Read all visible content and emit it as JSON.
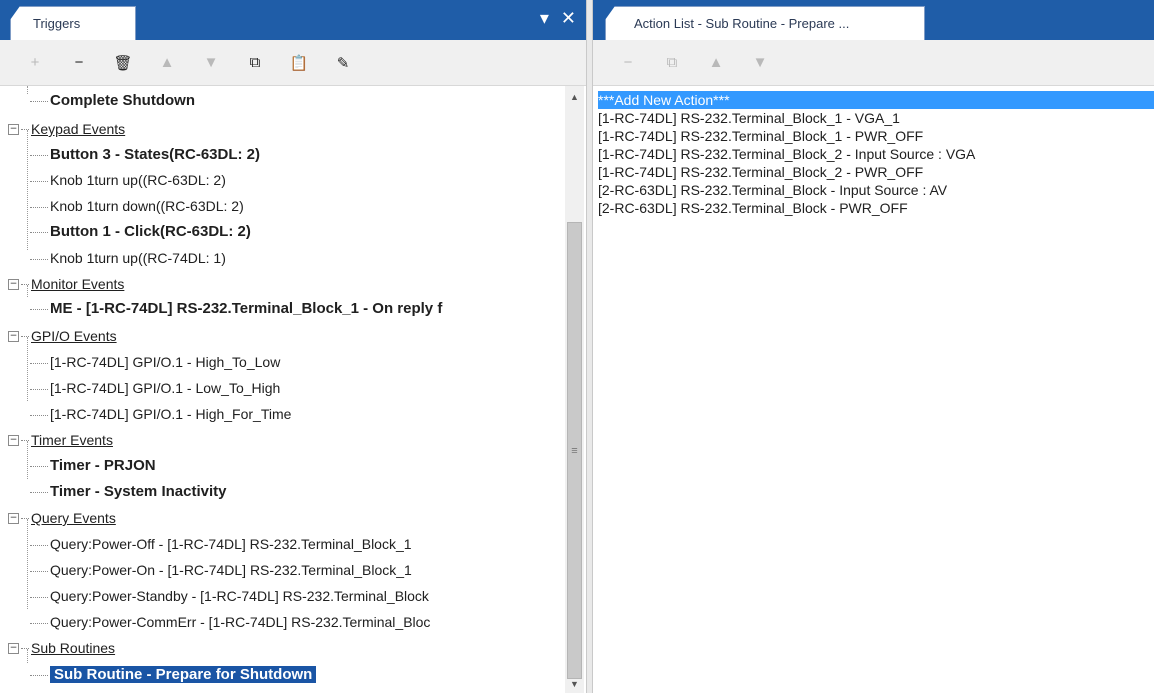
{
  "left": {
    "tab_title": "Triggers",
    "ctrl_dropdown": "▾",
    "ctrl_close": "✕",
    "toolbar": [
      {
        "name": "add-button",
        "glyph": "+",
        "enabled": false
      },
      {
        "name": "remove-button",
        "glyph": "−",
        "enabled": true
      },
      {
        "name": "delete-button",
        "glyph": "🗑",
        "enabled": true
      },
      {
        "name": "move-up-button",
        "glyph": "▲",
        "enabled": false
      },
      {
        "name": "move-down-button",
        "glyph": "▼",
        "enabled": false
      },
      {
        "name": "copy-button",
        "glyph": "⧉",
        "enabled": true
      },
      {
        "name": "paste-button",
        "glyph": "📋",
        "enabled": false
      },
      {
        "name": "edit-button",
        "glyph": "✎",
        "enabled": true
      }
    ],
    "tree": {
      "r0": "Complete Shutdown",
      "cat_keypad": "Keypad Events",
      "k1": "Button 3 - States(RC-63DL: 2)",
      "k2": "Knob 1turn up((RC-63DL: 2)",
      "k3": "Knob 1turn down((RC-63DL: 2)",
      "k4": "Button 1 - Click(RC-63DL: 2)",
      "k5": "Knob 1turn up((RC-74DL: 1)",
      "cat_monitor": "Monitor Events",
      "m1": "ME - [1-RC-74DL] RS-232.Terminal_Block_1 - On reply f",
      "cat_gpio": "GPI/O Events",
      "g1": "[1-RC-74DL] GPI/O.1 - High_To_Low",
      "g2": "[1-RC-74DL] GPI/O.1 - Low_To_High",
      "g3": "[1-RC-74DL] GPI/O.1 - High_For_Time",
      "cat_timer": "Timer Events",
      "t1": "Timer - PRJON",
      "t2": "Timer - System Inactivity",
      "cat_query": "Query Events",
      "q1": "Query:Power-Off - [1-RC-74DL] RS-232.Terminal_Block_1",
      "q2": "Query:Power-On - [1-RC-74DL] RS-232.Terminal_Block_1",
      "q3": "Query:Power-Standby - [1-RC-74DL] RS-232.Terminal_Block",
      "q4": "Query:Power-CommErr - [1-RC-74DL] RS-232.Terminal_Bloc",
      "cat_sub": "Sub Routines",
      "s1": "Sub Routine - Prepare for Shutdown"
    }
  },
  "right": {
    "tab_title": "Action List - Sub Routine - Prepare ...",
    "toolbar": [
      {
        "name": "remove-action-button",
        "glyph": "−",
        "enabled": false
      },
      {
        "name": "copy-action-button",
        "glyph": "⧉",
        "enabled": false
      },
      {
        "name": "move-action-up-button",
        "glyph": "▲",
        "enabled": false
      },
      {
        "name": "move-action-down-button",
        "glyph": "▼",
        "enabled": false
      }
    ],
    "actions": [
      "***Add New Action***",
      "[1-RC-74DL] RS-232.Terminal_Block_1 - VGA_1",
      "[1-RC-74DL] RS-232.Terminal_Block_1 - PWR_OFF",
      "[1-RC-74DL] RS-232.Terminal_Block_2 - Input Source : VGA",
      "[1-RC-74DL] RS-232.Terminal_Block_2 - PWR_OFF",
      "[2-RC-63DL] RS-232.Terminal_Block - Input Source : AV",
      "[2-RC-63DL] RS-232.Terminal_Block - PWR_OFF"
    ]
  },
  "colors": {
    "tab_bar": "#1f5da8",
    "selection": "#1a55a5",
    "highlight": "#3399ff"
  },
  "scroll": {
    "up_glyph": "▲",
    "down_glyph": "▼",
    "grip_glyph": "≡"
  }
}
